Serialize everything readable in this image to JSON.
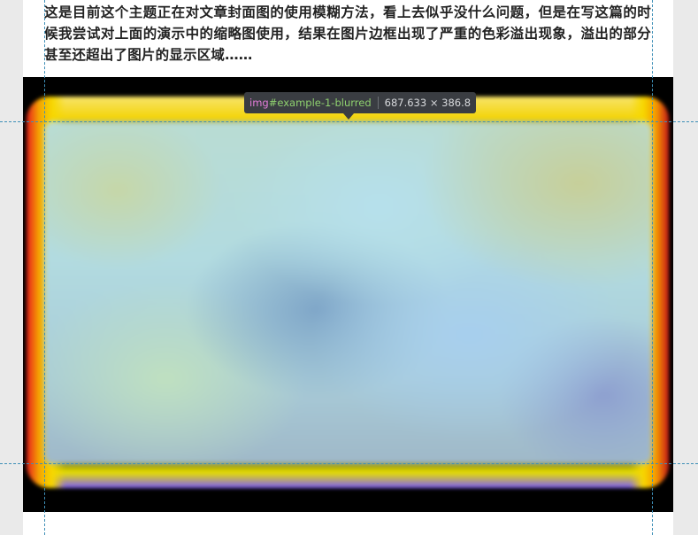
{
  "article": {
    "paragraph": "这是目前这个主题正在对文章封面图的使用模糊方法，看上去似乎没什么问题，但是在写这篇的时候我尝试对上面的演示中的缩略图使用，结果在图片边框出现了严重的色彩溢出现象，溢出的部分甚至还超出了图片的显示区域……"
  },
  "inspector": {
    "tag": "img",
    "id": "#example-1-blurred",
    "dimensions": "687.633 × 386.8"
  },
  "colors": {
    "tooltip_bg": "#3a3d42",
    "tag_color": "#e47ddb",
    "id_color": "#8fd16f",
    "guide_color": "#3e8fb7",
    "figure_bg": "#000000"
  }
}
